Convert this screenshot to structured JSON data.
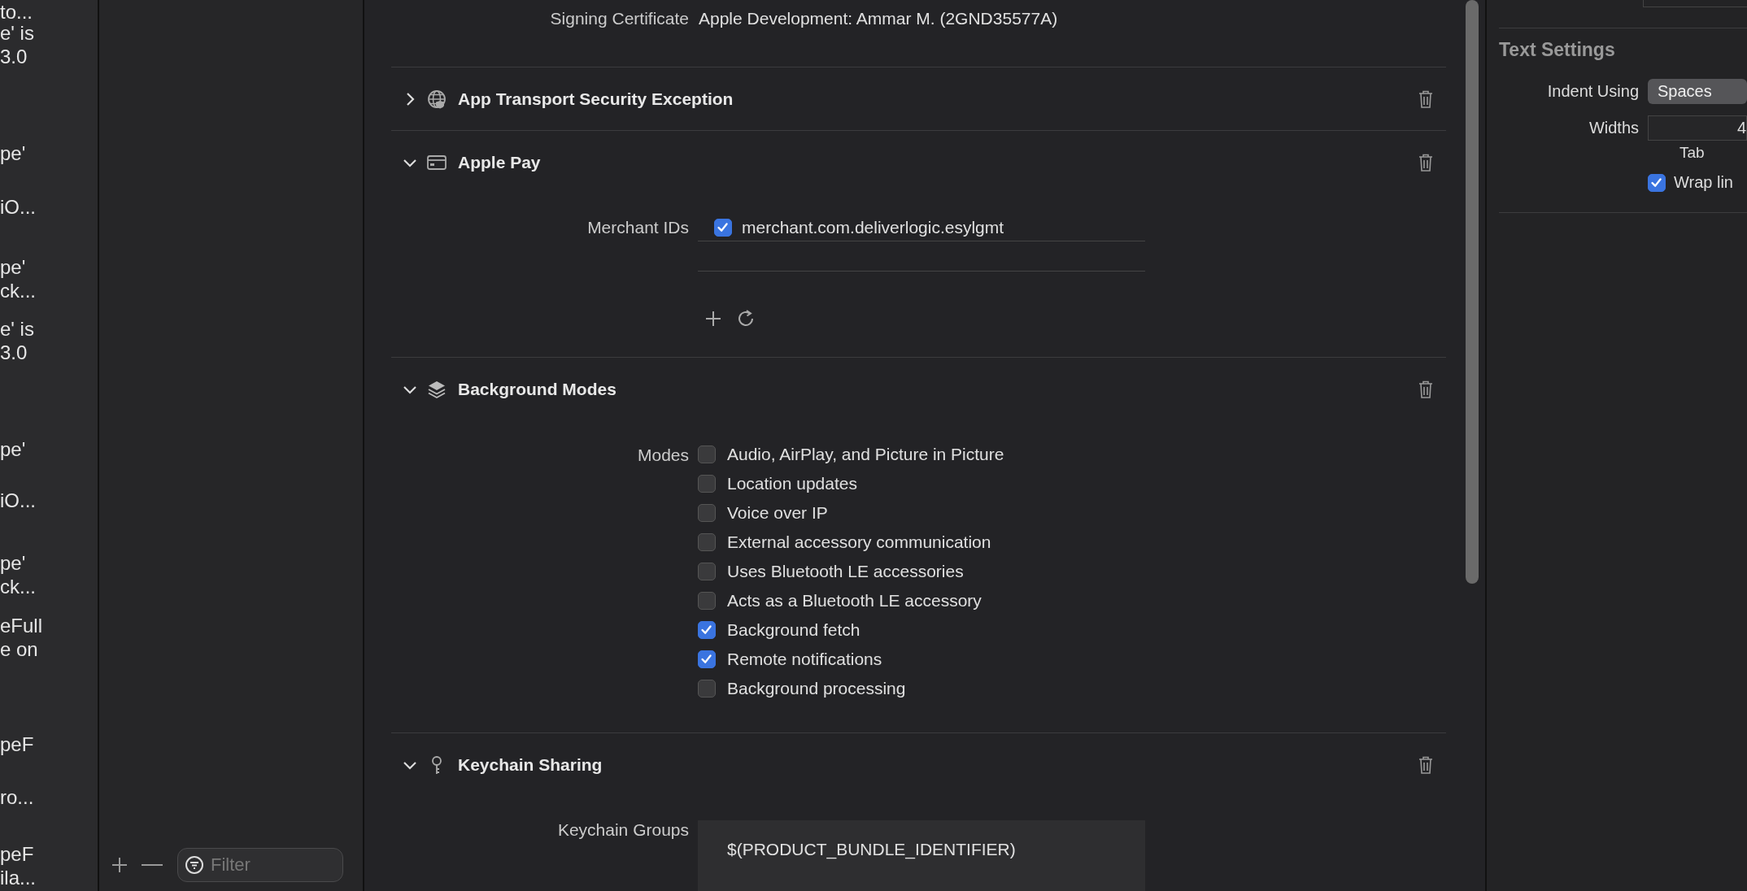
{
  "issues": [
    {
      "lines": [
        "to..."
      ]
    },
    {
      "lines": [
        "e' is",
        "3.0"
      ]
    },
    {
      "lines": [
        "pe'"
      ]
    },
    {
      "lines": [
        "iO..."
      ]
    },
    {
      "lines": [
        "pe'",
        "ck..."
      ]
    },
    {
      "lines": [
        "e' is",
        "3.0"
      ]
    },
    {
      "lines": [
        "pe'"
      ]
    },
    {
      "lines": [
        "iO..."
      ]
    },
    {
      "lines": [
        "pe'",
        "ck..."
      ]
    },
    {
      "lines": [
        "eFull",
        "e on"
      ]
    },
    {
      "lines": [
        "peF"
      ]
    },
    {
      "lines": [
        "ro..."
      ]
    },
    {
      "lines": [
        "peF",
        "ila..."
      ]
    }
  ],
  "source_list": {
    "filter_placeholder": "Filter"
  },
  "signing": {
    "label": "Signing Certificate",
    "value": "Apple Development: Ammar M. (2GND35577A)"
  },
  "capabilities": [
    {
      "title": "App Transport Security Exception",
      "expanded": false
    },
    {
      "title": "Apple Pay",
      "expanded": true,
      "kind": "list",
      "label": "Merchant IDs",
      "items": [
        {
          "text": "merchant.com.deliverlogic.esylgmt",
          "checked": true
        }
      ]
    },
    {
      "title": "Background Modes",
      "expanded": true,
      "kind": "checklist",
      "label": "Modes",
      "items": [
        {
          "text": "Audio, AirPlay, and Picture in Picture",
          "checked": false
        },
        {
          "text": "Location updates",
          "checked": false
        },
        {
          "text": "Voice over IP",
          "checked": false
        },
        {
          "text": "External accessory communication",
          "checked": false
        },
        {
          "text": "Uses Bluetooth LE accessories",
          "checked": false
        },
        {
          "text": "Acts as a Bluetooth LE accessory",
          "checked": false
        },
        {
          "text": "Background fetch",
          "checked": true
        },
        {
          "text": "Remote notifications",
          "checked": true
        },
        {
          "text": "Background processing",
          "checked": false
        }
      ]
    },
    {
      "title": "Keychain Sharing",
      "expanded": true,
      "kind": "table",
      "label": "Keychain Groups",
      "items": [
        {
          "text": "$(PRODUCT_BUNDLE_IDENTIFIER)"
        }
      ]
    }
  ],
  "inspector": {
    "title": "Text Settings",
    "indent_label": "Indent Using",
    "indent_value": "Spaces",
    "widths_label": "Widths",
    "tab_value": "4",
    "tab_caption": "Tab",
    "wrap": {
      "label": "Wrap lin",
      "checked": true
    }
  }
}
